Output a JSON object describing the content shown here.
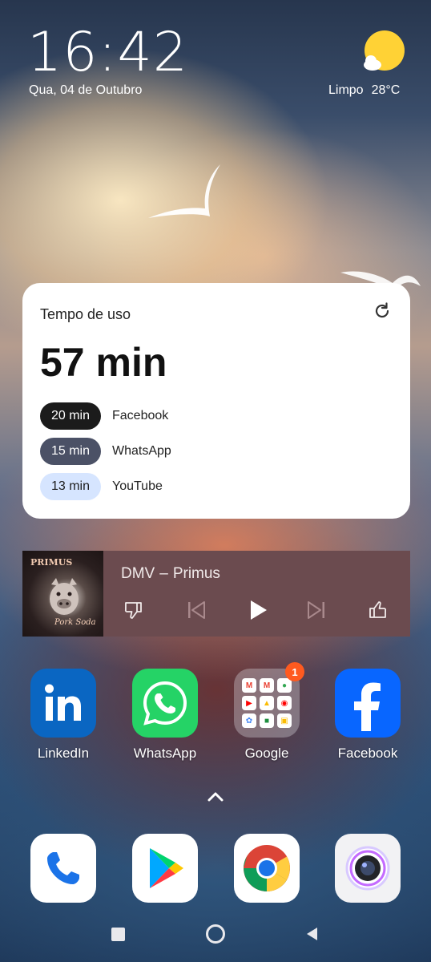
{
  "status": {
    "time": "16:42",
    "date": "Qua, 04 de Outubro",
    "weather": {
      "condition": "Limpo",
      "temperature": "28°C"
    }
  },
  "usage_widget": {
    "title": "Tempo de uso",
    "total": "57 min",
    "apps": [
      {
        "time": "20 min",
        "app": "Facebook"
      },
      {
        "time": "15 min",
        "app": "WhatsApp"
      },
      {
        "time": "13 min",
        "app": "YouTube"
      }
    ]
  },
  "music_widget": {
    "track": "DMV",
    "separator": "–",
    "artist": "Primus",
    "album_art_text": "PRIMUS",
    "album_art_subtitle": "Pork Soda"
  },
  "apps": [
    {
      "label": "LinkedIn",
      "icon": "linkedin-icon",
      "color": "#0a66c2"
    },
    {
      "label": "WhatsApp",
      "icon": "whatsapp-icon",
      "color": "#25d366"
    },
    {
      "label": "Google",
      "icon": "google-folder-icon",
      "badge": "1"
    },
    {
      "label": "Facebook",
      "icon": "facebook-icon",
      "color": "#0866ff"
    }
  ],
  "dock": [
    {
      "icon": "phone-icon"
    },
    {
      "icon": "play-store-icon"
    },
    {
      "icon": "chrome-icon"
    },
    {
      "icon": "camera-icon"
    }
  ]
}
